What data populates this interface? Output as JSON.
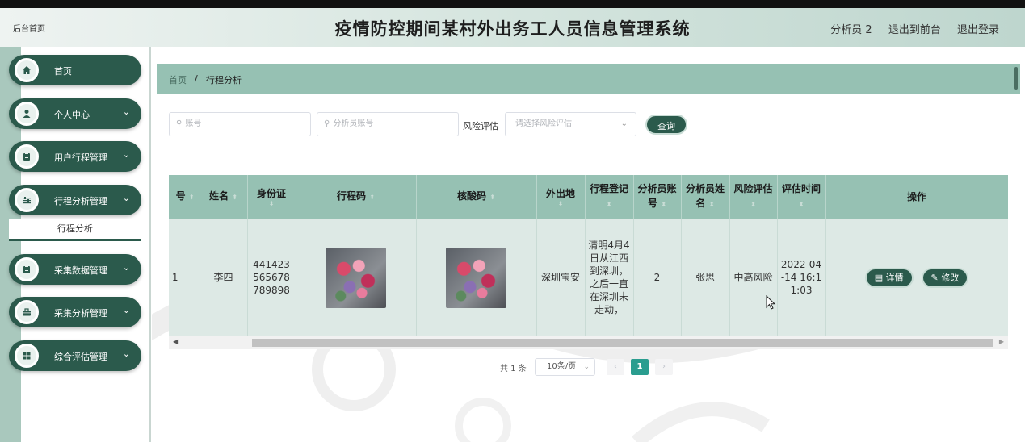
{
  "header": {
    "small_title": "后台首页",
    "title": "疫情防控期间某村外出务工人员信息管理系统",
    "user": "分析员 2",
    "front_link": "退出到前台",
    "logout_link": "退出登录"
  },
  "sidebar": {
    "items": [
      {
        "label": "首页",
        "icon": "home-icon"
      },
      {
        "label": "个人中心",
        "icon": "user-icon"
      },
      {
        "label": "用户行程管理",
        "icon": "clipboard-icon"
      },
      {
        "label": "行程分析管理",
        "icon": "sliders-icon"
      },
      {
        "label": "采集数据管理",
        "icon": "clipboard-icon"
      },
      {
        "label": "采集分析管理",
        "icon": "briefcase-icon"
      },
      {
        "label": "综合评估管理",
        "icon": "grid-icon"
      }
    ],
    "submenu_active": "行程分析"
  },
  "breadcrumb": {
    "home": "首页",
    "sep": "/",
    "current": "行程分析"
  },
  "search": {
    "account_placeholder": "账号",
    "analyst_placeholder": "分析员账号",
    "risk_label": "风险评估",
    "risk_placeholder": "请选择风险评估",
    "query_button": "查询"
  },
  "table": {
    "headers": [
      "号",
      "姓名",
      "身份证",
      "行程码",
      "核酸码",
      "外出地",
      "行程登记",
      "分析员账号",
      "分析员姓名",
      "风险评估",
      "评估时间",
      "操作"
    ],
    "rows": [
      {
        "index": "1",
        "name": "李四",
        "id_card": "441423565678789898",
        "destination": "深圳宝安",
        "travel_record": "清明4月4日从江西到深圳，之后一直在深圳未走动，",
        "analyst_account": "2",
        "analyst_name": "张思",
        "risk": "中高风险",
        "eval_time": "2022-04-14 16:11:03"
      }
    ],
    "actions": {
      "detail": "详情",
      "edit": "修改"
    }
  },
  "pagination": {
    "total": "共 1 条",
    "page_size": "10条/页",
    "prev": "‹",
    "current": "1",
    "next": "›"
  }
}
